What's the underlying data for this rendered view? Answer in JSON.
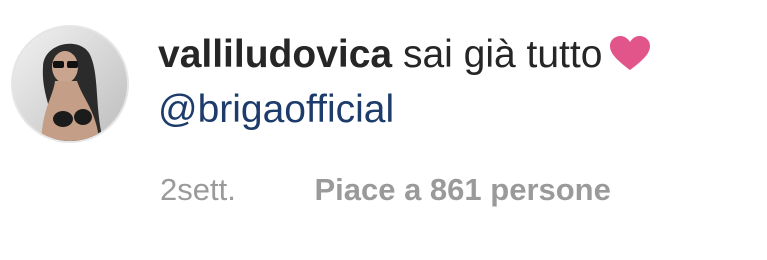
{
  "comment": {
    "username": "valliludovica",
    "text": "sai già tutto",
    "emoji_icon": "heart-icon",
    "heart_color": "#e2558a",
    "mention": "@brigaofficial",
    "timestamp": "2sett.",
    "likes_label": "Piace a 861 persone"
  }
}
